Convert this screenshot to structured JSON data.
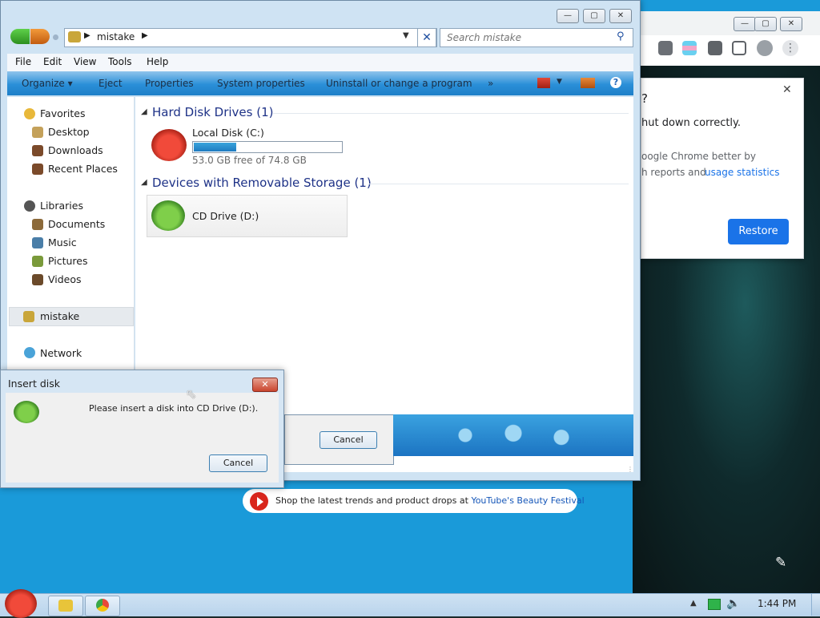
{
  "explorer": {
    "breadcrumb": "mistake",
    "search_placeholder": "Search mistake",
    "menu": [
      "File",
      "Edit",
      "View",
      "Tools",
      "Help"
    ],
    "commands": [
      "Organize ▾",
      "Eject",
      "Properties",
      "System properties",
      "Uninstall or change a program",
      "»"
    ],
    "nav": {
      "favorites": "Favorites",
      "desktop": "Desktop",
      "downloads": "Downloads",
      "recent": "Recent Places",
      "libraries": "Libraries",
      "documents": "Documents",
      "music": "Music",
      "pictures": "Pictures",
      "videos": "Videos",
      "selected": "mistake",
      "network": "Network"
    },
    "groups": {
      "hdd_title": "Hard Disk Drives (1)",
      "removable_title": "Devices with Removable Storage (1)"
    },
    "drive_c": {
      "name": "Local Disk (C:)",
      "space": "53.0 GB free of 74.8 GB",
      "used_fraction": 0.29
    },
    "drive_d": {
      "name": "CD Drive (D:)"
    },
    "bg_cancel": "Cancel"
  },
  "dialog": {
    "title": "Insert disk",
    "message": "Please insert a disk into CD Drive (D:).",
    "cancel": "Cancel",
    "close": "✕"
  },
  "chrome": {
    "popup_line1": "?",
    "popup_line2": "hut down correctly.",
    "popup_line3": "oogle Chrome better by",
    "popup_line4": "h reports and",
    "popup_link": "usage statistics",
    "restore": "Restore",
    "close": "✕"
  },
  "banner": {
    "text": "Shop the latest trends and product drops at ",
    "link": "YouTube's Beauty Festival"
  },
  "taskbar": {
    "time": "1:44 PM"
  }
}
